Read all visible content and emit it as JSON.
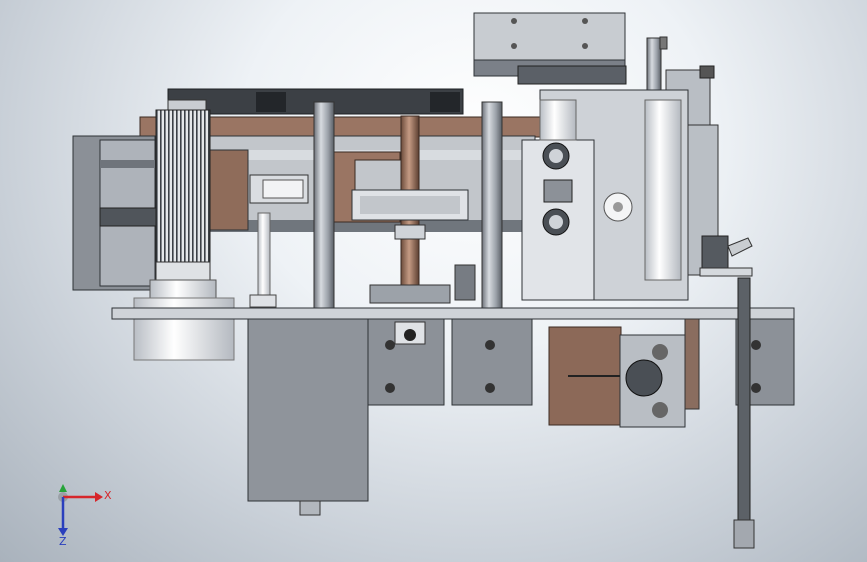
{
  "viewport": {
    "background": "cad-gradient",
    "model": "machine-assembly-front-view"
  },
  "triad": {
    "x_label": "X",
    "z_label": "Z",
    "x_color": "#d6262b",
    "y_color": "#27a43a",
    "z_color": "#2a3fbd"
  },
  "colors": {
    "steel_light": "#d9dde2",
    "steel_mid": "#a7adb5",
    "steel_dark": "#5d6269",
    "bronze": "#8e6a56",
    "dark": "#3e4247"
  }
}
